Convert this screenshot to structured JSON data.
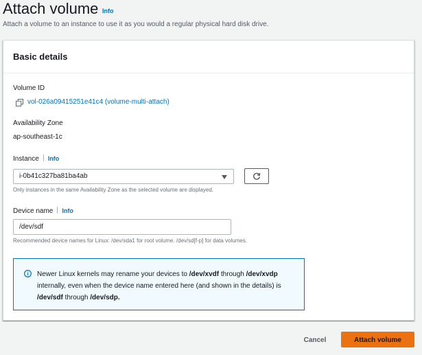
{
  "page": {
    "title": "Attach volume",
    "title_info": "Info",
    "description": "Attach a volume to an instance to use it as you would a regular physical hard disk drive."
  },
  "panel": {
    "title": "Basic details",
    "volume_id": {
      "label": "Volume ID",
      "value": "vol-026a09415251e41c4 (volume-multi-attach)",
      "icon": "copy-icon"
    },
    "availability_zone": {
      "label": "Availability Zone",
      "value": "ap-southeast-1c"
    },
    "instance": {
      "label": "Instance",
      "info": "Info",
      "selected": "i-0b41c327ba81ba4ab",
      "hint": "Only instances in the same Availability Zone as the selected volume are displayed.",
      "refresh_icon": "refresh-icon"
    },
    "device_name": {
      "label": "Device name",
      "info": "Info",
      "value": "/dev/sdf",
      "hint": "Recommended device names for Linux: /dev/sda1 for root volume. /dev/sd[f-p] for data volumes."
    },
    "alert": {
      "icon": "info-circle-icon",
      "t1": "Newer Linux kernels may rename your devices to ",
      "b1": "/dev/xvdf",
      "t2": " through ",
      "b2": "/dev/xvdp",
      "t3": " internally, even when the device name entered here (and shown in the details) is ",
      "b3": "/dev/sdf",
      "t4": " through ",
      "b4": "/dev/sdp."
    }
  },
  "actions": {
    "cancel": "Cancel",
    "submit": "Attach volume"
  },
  "colors": {
    "primary": "#ec7211",
    "link": "#0073bb",
    "alert_bg": "#f1faff"
  }
}
